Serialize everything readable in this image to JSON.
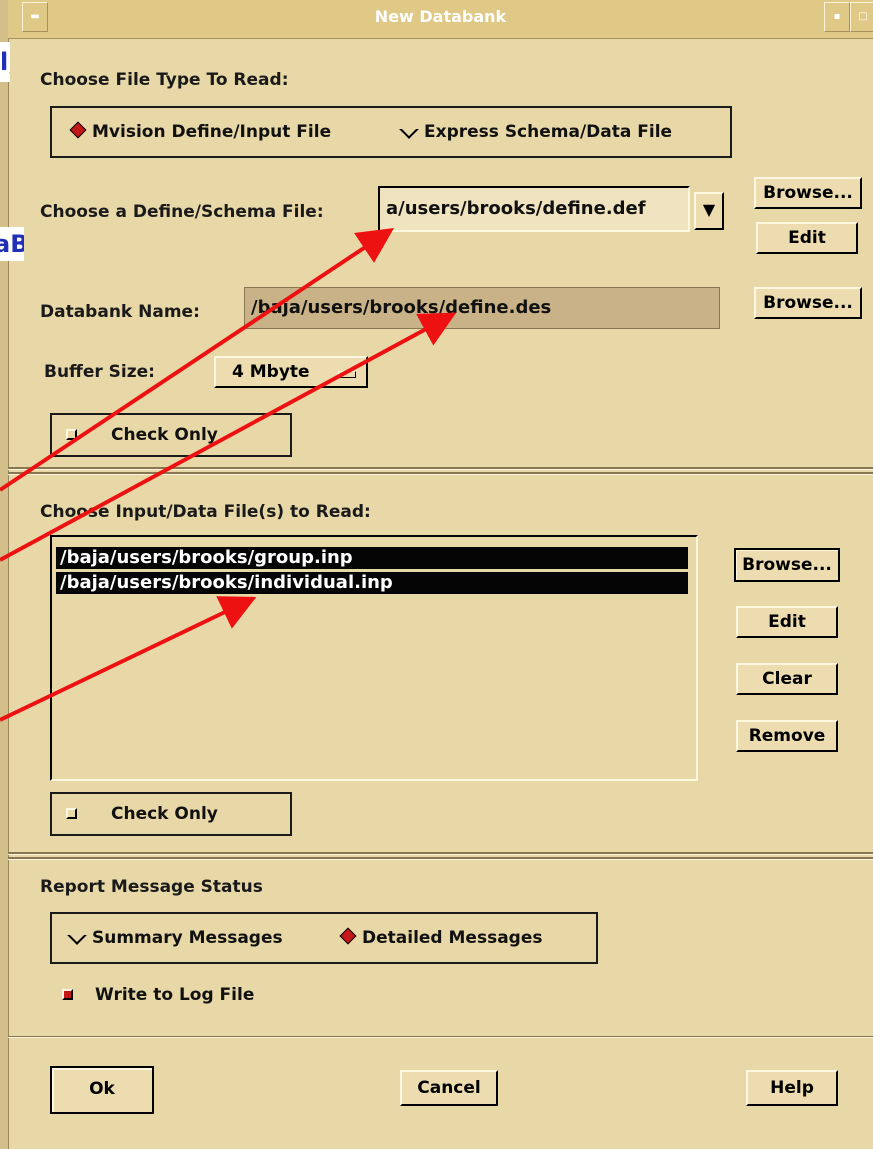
{
  "window": {
    "title": "New Databank"
  },
  "annotations": {
    "fragment_top": "l,",
    "fragment_mid": "aB"
  },
  "file_type": {
    "label": "Choose File Type To Read:",
    "options": [
      {
        "label": "Mvision Define/Input File",
        "selected": true
      },
      {
        "label": "Express Schema/Data File",
        "selected": false
      }
    ]
  },
  "define_file": {
    "label": "Choose a Define/Schema File:",
    "value": "a/users/brooks/define.def",
    "browse_label": "Browse...",
    "edit_label": "Edit"
  },
  "databank": {
    "label": "Databank Name:",
    "value": "/baja/users/brooks/define.des",
    "browse_label": "Browse..."
  },
  "buffer": {
    "label": "Buffer Size:",
    "value": "4 Mbyte"
  },
  "check_only_top": {
    "label": "Check Only",
    "checked": false
  },
  "input_files": {
    "label": "Choose Input/Data File(s) to Read:",
    "items": [
      "/baja/users/brooks/group.inp",
      "/baja/users/brooks/individual.inp"
    ],
    "browse_label": "Browse...",
    "edit_label": "Edit",
    "clear_label": "Clear",
    "remove_label": "Remove"
  },
  "check_only_bottom": {
    "label": "Check Only",
    "checked": false
  },
  "report": {
    "label": "Report Message Status",
    "options": [
      {
        "label": "Summary Messages",
        "selected": false
      },
      {
        "label": "Detailed Messages",
        "selected": true
      }
    ],
    "log_label": "Write to Log File",
    "log_checked": true
  },
  "footer": {
    "ok_label": "Ok",
    "cancel_label": "Cancel",
    "help_label": "Help"
  },
  "colors": {
    "dialog_bg": "#e8d8a8",
    "field_bg": "#c9b287",
    "selection": "#050505",
    "annotation_arrow": "#ee1111",
    "annotation_text": "#1f2fb8",
    "radio_on": "#c41818"
  }
}
